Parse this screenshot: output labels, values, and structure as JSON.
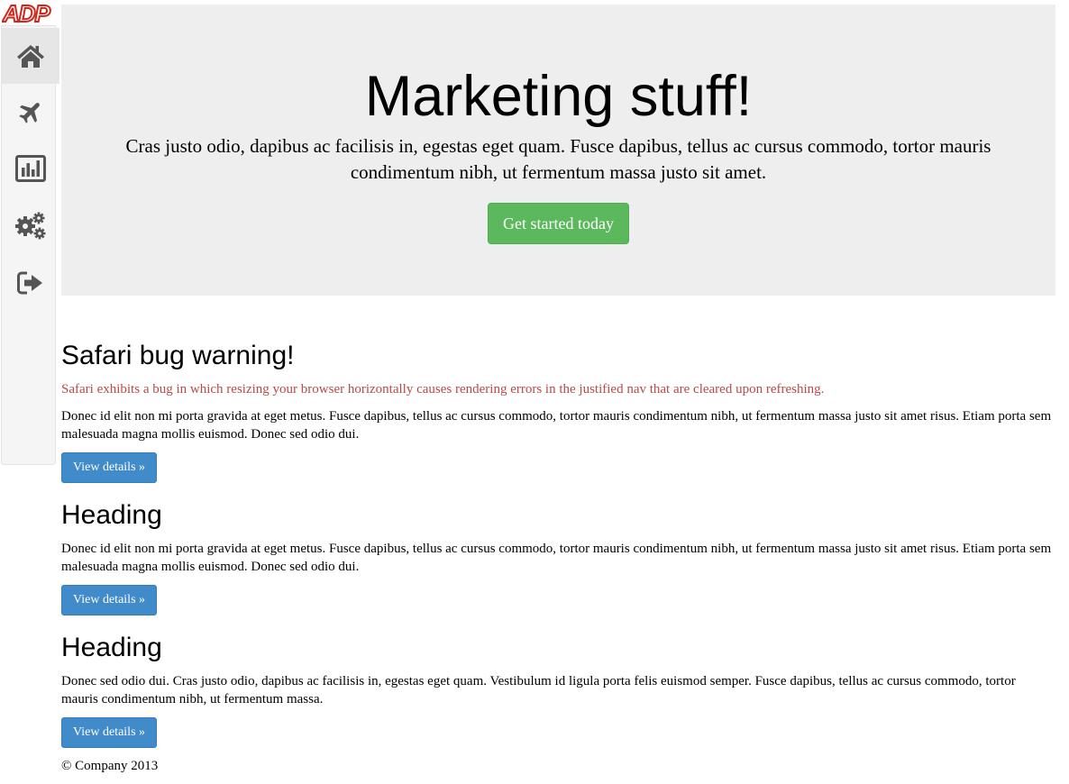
{
  "logo": {
    "text": "ADP",
    "color": "#d0271d"
  },
  "sidebar": {
    "items": [
      {
        "icon": "home-icon",
        "active": true
      },
      {
        "icon": "plane-icon",
        "active": false
      },
      {
        "icon": "bar-chart-icon",
        "active": false
      },
      {
        "icon": "gears-icon",
        "active": false
      },
      {
        "icon": "sign-out-icon",
        "active": false
      }
    ]
  },
  "jumbotron": {
    "title": "Marketing stuff!",
    "lead": "Cras justo odio, dapibus ac facilisis in, egestas eget quam. Fusce dapibus, tellus ac cursus commodo, tortor mauris condimentum nibh, ut fermentum massa justo sit amet.",
    "button_label": "Get started today"
  },
  "sections": [
    {
      "title": "Safari bug warning!",
      "warning": "Safari exhibits a bug in which resizing your browser horizontally causes rendering errors in the justified nav that are cleared upon refreshing.",
      "body": "Donec id elit non mi porta gravida at eget metus. Fusce dapibus, tellus ac cursus commodo, tortor mauris condimentum nibh, ut fermentum massa justo sit amet risus. Etiam porta sem malesuada magna mollis euismod. Donec sed odio dui.",
      "button_label": "View details »"
    },
    {
      "title": "Heading",
      "body": "Donec id elit non mi porta gravida at eget metus. Fusce dapibus, tellus ac cursus commodo, tortor mauris condimentum nibh, ut fermentum massa justo sit amet risus. Etiam porta sem malesuada magna mollis euismod. Donec sed odio dui.",
      "button_label": "View details »"
    },
    {
      "title": "Heading",
      "body": "Donec sed odio dui. Cras justo odio, dapibus ac facilisis in, egestas eget quam. Vestibulum id ligula porta felis euismod semper. Fusce dapibus, tellus ac cursus commodo, tortor mauris condimentum nibh, ut fermentum massa.",
      "button_label": "View details »"
    }
  ],
  "footer": {
    "text": "© Company 2013"
  },
  "colors": {
    "success": "#5cb85c",
    "primary": "#428bca",
    "warning_text": "#b94a48",
    "jumbotron_bg": "#eeeeee",
    "icon": "#555555"
  }
}
